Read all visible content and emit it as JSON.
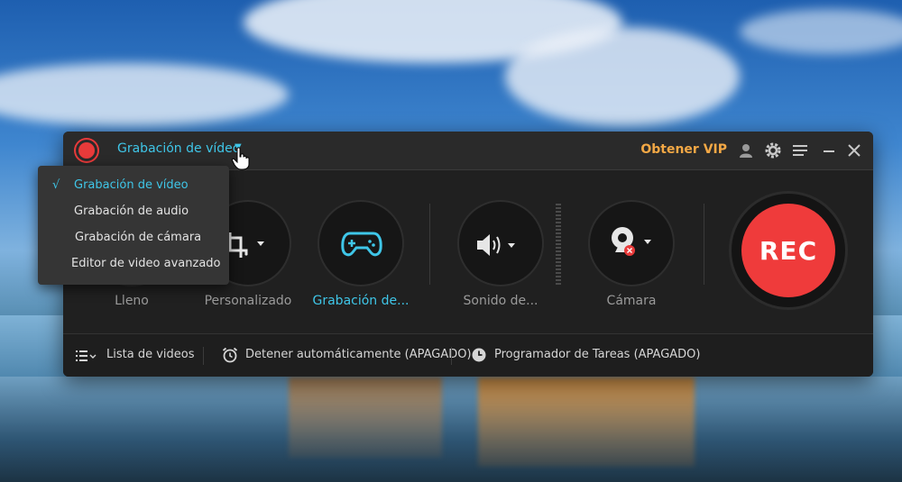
{
  "app": {
    "mode_title": "Grabación de vídeo",
    "vip_label": "Obtener VIP"
  },
  "dropdown": {
    "items": [
      {
        "label": "Grabación de vídeo",
        "selected": true
      },
      {
        "label": "Grabación de audio",
        "selected": false
      },
      {
        "label": "Grabación de cámara",
        "selected": false
      },
      {
        "label": "Editor de video avanzado",
        "selected": false
      }
    ],
    "check_mark": "√"
  },
  "main": {
    "area_full_label": "Lleno",
    "area_custom_label": "Personalizado",
    "game_label": "Grabación de...",
    "sound_label": "Sonido de...",
    "camera_label": "Cámara",
    "rec_label": "REC"
  },
  "bottom": {
    "video_list": "Lista de videos",
    "auto_stop": "Detener automáticamente (APAGADO)",
    "scheduler": "Programador de Tareas (APAGADO)"
  },
  "colors": {
    "accent": "#3fc6e8",
    "vip": "#f3a845",
    "rec": "#ef3b3b",
    "window_bg": "#202020"
  },
  "icons": [
    "record-logo-icon",
    "chevron-down-icon",
    "account-icon",
    "gear-icon",
    "menu-icon",
    "minimize-icon",
    "close-icon",
    "crop-icon",
    "gamepad-icon",
    "speaker-icon",
    "webcam-icon",
    "list-icon",
    "alarm-clock-icon",
    "clock-icon",
    "hand-cursor-icon"
  ]
}
